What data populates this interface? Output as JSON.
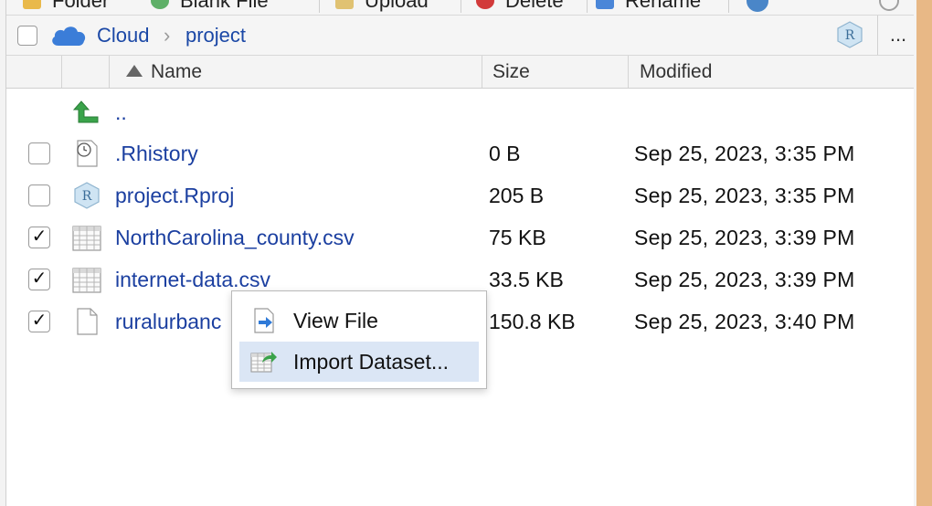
{
  "toolbar": {
    "items": [
      "Folder",
      "Blank File",
      "Upload",
      "Delete",
      "Rename"
    ]
  },
  "breadcrumb": {
    "root": "Cloud",
    "current": "project",
    "more": "..."
  },
  "columns": {
    "name": "Name",
    "size": "Size",
    "modified": "Modified",
    "sort": "ascending"
  },
  "files": [
    {
      "name": "..",
      "size": "",
      "modified": "",
      "checked": false,
      "icon": "up-arrow-icon"
    },
    {
      "name": ".Rhistory",
      "size": "0 B",
      "modified": "Sep 25, 2023, 3:35 PM",
      "checked": false,
      "icon": "history-file-icon"
    },
    {
      "name": "project.Rproj",
      "size": "205 B",
      "modified": "Sep 25, 2023, 3:35 PM",
      "checked": false,
      "icon": "rproj-file-icon"
    },
    {
      "name": "NorthCarolina_county.csv",
      "size": "75 KB",
      "modified": "Sep 25, 2023, 3:39 PM",
      "checked": true,
      "icon": "csv-file-icon"
    },
    {
      "name": "internet-data.csv",
      "size": "33.5 KB",
      "modified": "Sep 25, 2023, 3:39 PM",
      "checked": true,
      "icon": "csv-file-icon"
    },
    {
      "name": "ruralurbanc",
      "size": "150.8 KB",
      "modified": "Sep 25, 2023, 3:40 PM",
      "checked": true,
      "icon": "blank-file-icon"
    }
  ],
  "context_menu": {
    "items": [
      {
        "label": "View File",
        "icon": "view-file-icon",
        "highlighted": false
      },
      {
        "label": "Import Dataset...",
        "icon": "import-dataset-icon",
        "highlighted": true
      }
    ]
  },
  "colors": {
    "link": "#1b3fa0",
    "highlight": "#dbe6f5",
    "up_arrow": "#3aa34a",
    "cloud": "#3b7dd8"
  }
}
